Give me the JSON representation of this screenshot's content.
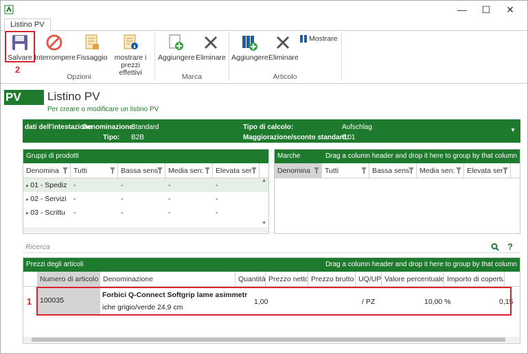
{
  "window": {
    "tab": "Listino PV",
    "minimize": "—",
    "maximize": "☐",
    "close": "✕"
  },
  "ribbon": {
    "save": "Salvare",
    "interrupt": "Interrompere",
    "fix": "Fissaggio",
    "show_prices": "mostrare i prezzi effettivi",
    "group_options": "Opzioni",
    "brand_add": "Aggiungere",
    "brand_delete": "Eliminare",
    "group_brand": "Marca",
    "article_add": "Aggiungere",
    "article_delete": "Eliminare",
    "show": "Mostrare",
    "group_article": "Articolo",
    "step_save": "2"
  },
  "header": {
    "badge": "PV",
    "title": "Listino PV",
    "subtitle": "Per creare o modificare un listino PV"
  },
  "details": {
    "section": "dati dell'intestazione",
    "denominazione_label": "Denominazione:",
    "denominazione_value": "Standard",
    "tipo_label": "Tipo:",
    "tipo_value": "B2B",
    "tipo_calcolo_label": "Tipo di calcolo:",
    "tipo_calcolo_value": "Aufschlag",
    "maggiorazione_label": "Maggiorazione/sconto standard:",
    "maggiorazione_value": "0,01"
  },
  "product_groups": {
    "title": "Gruppi di prodotti",
    "columns": [
      "Denomina",
      "Tutti",
      "Bassa sens",
      "Media sen:",
      "Elevata ser"
    ],
    "rows": [
      [
        "01 - Spediz",
        "-",
        "-",
        "-",
        "-"
      ],
      [
        "02 - Servizi",
        "-",
        "-",
        "-",
        "-"
      ],
      [
        "03 - Scrittu",
        "-",
        "-",
        "-",
        "-"
      ]
    ]
  },
  "brands": {
    "title": "Marche",
    "drag_hint": "Drag a column header and drop it here to group by that column",
    "columns": [
      "Denomina",
      "Tutti",
      "Bassa sens",
      "Media sen:",
      "Elevata ser"
    ]
  },
  "search": {
    "placeholder": "Ricerca",
    "help": "?"
  },
  "prices": {
    "title": "Prezzi degli articoli",
    "drag_hint": "Drag a column header and drop it here to group by that column",
    "columns": [
      "Numero di articolo",
      "Denominazione",
      "Quantità",
      "Prezzo netto",
      "Prezzo brutto",
      "UQ/UP",
      "Valore percentuale",
      "Importo di copertu"
    ],
    "row": {
      "number": "100035",
      "name_line1": "Forbici Q-Connect Softgrip lame asimmetr",
      "name_line2": "iche grigio/verde 24,9 cm",
      "quantity": "1,00",
      "uq": "/ PZ",
      "percent": "10,00 %",
      "amount": "0,15"
    },
    "step_row": "1"
  },
  "colors": {
    "accent": "#1e7a2c",
    "highlight": "#d9232f"
  }
}
